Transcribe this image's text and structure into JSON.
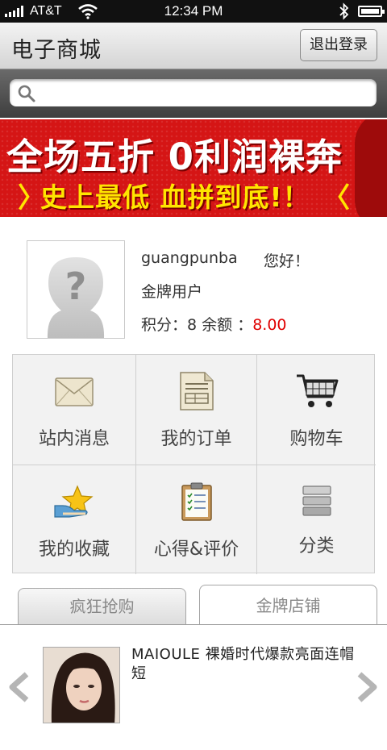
{
  "status_bar": {
    "carrier": "AT&T",
    "time": "12:34 PM"
  },
  "header": {
    "title": "电子商城",
    "logout_label": "退出登录"
  },
  "search": {
    "placeholder": ""
  },
  "banner": {
    "line1": "全场五折 0利润裸奔",
    "line2": "史上最低  血拼到底!！"
  },
  "profile": {
    "username": "guangpunba",
    "greeting": "您好！",
    "level": "金牌用户",
    "points_label": "积分：",
    "points_value": "8",
    "balance_label": " 余额 ：",
    "balance_value": "8.00"
  },
  "grid": {
    "items": [
      {
        "label": "站内消息",
        "icon": "mail-icon"
      },
      {
        "label": "我的订单",
        "icon": "document-icon"
      },
      {
        "label": "购物车",
        "icon": "shopping-cart-icon"
      },
      {
        "label": "我的收藏",
        "icon": "star-hand-icon"
      },
      {
        "label": "心得&评价",
        "icon": "clipboard-icon"
      },
      {
        "label": "分类",
        "icon": "stack-icon"
      }
    ]
  },
  "tabs": [
    {
      "label": "疯狂抢购"
    },
    {
      "label": "金牌店铺"
    }
  ],
  "product": {
    "title": "MAIOULE 裸婚时代爆款亮面连帽短"
  },
  "colors": {
    "banner_red": "#d51515",
    "banner_yellow": "#ffe500",
    "balance_red": "#e00000"
  }
}
